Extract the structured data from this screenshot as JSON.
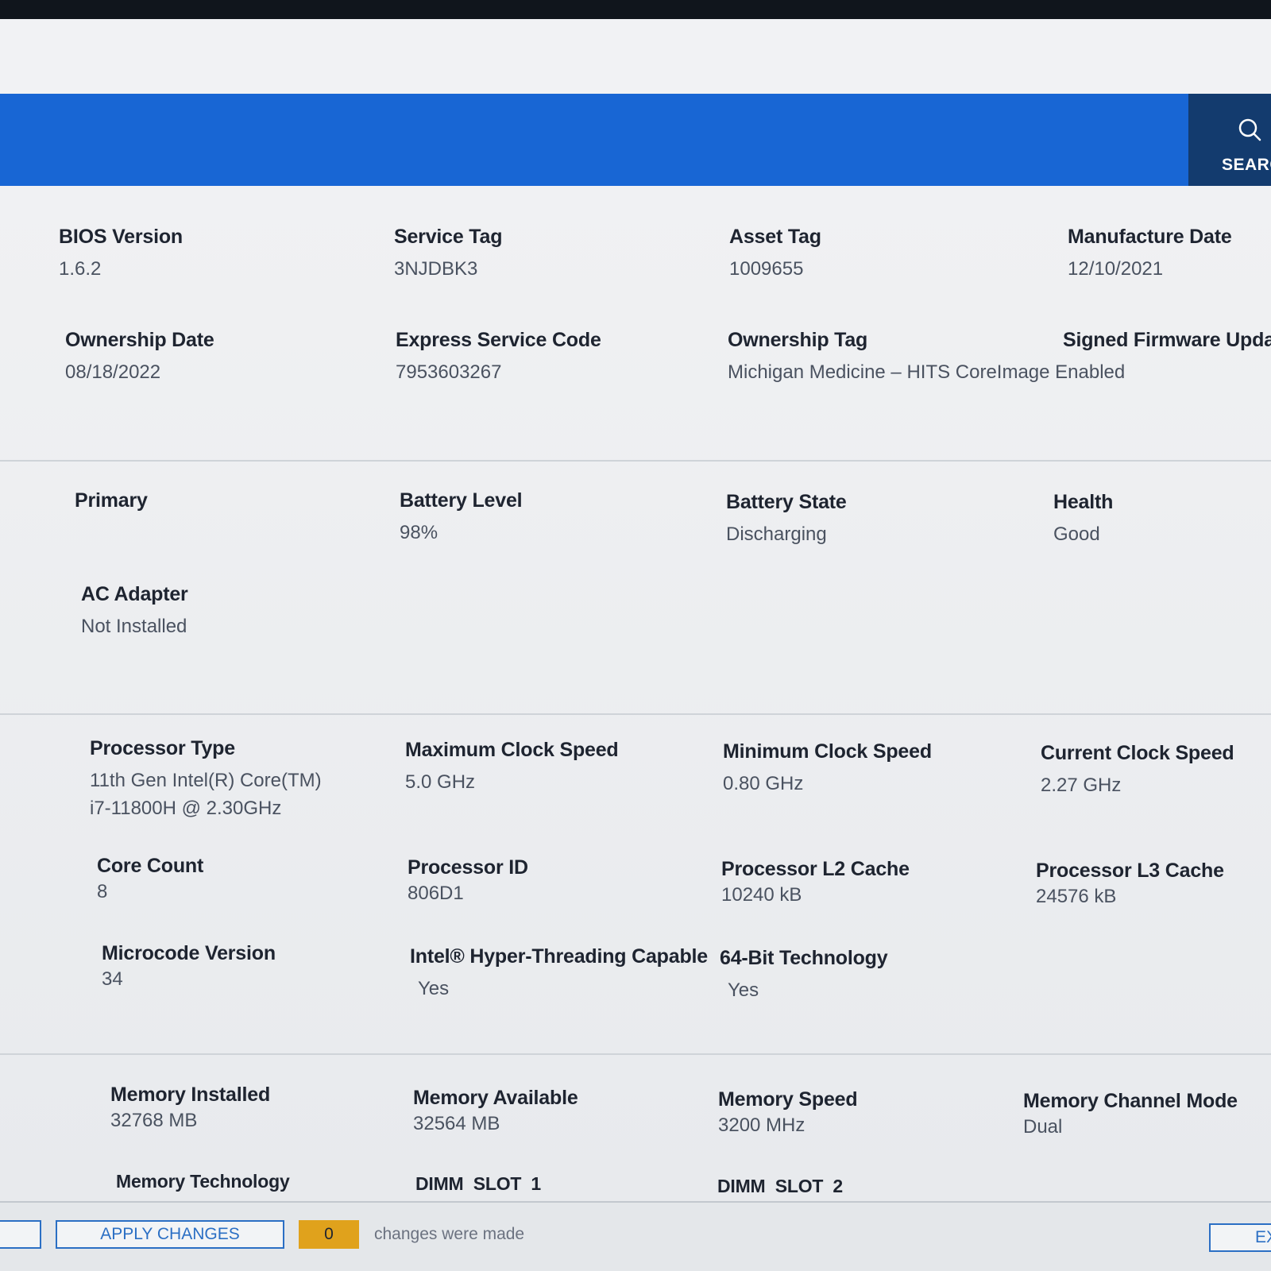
{
  "search": {
    "label": "SEARCH"
  },
  "system": {
    "bios_version": {
      "label": "BIOS Version",
      "value": "1.6.2"
    },
    "service_tag": {
      "label": "Service Tag",
      "value": "3NJDBK3"
    },
    "asset_tag": {
      "label": "Asset Tag",
      "value": "1009655"
    },
    "manufacture_date": {
      "label": "Manufacture Date",
      "value": "12/10/2021"
    },
    "ownership_date": {
      "label": "Ownership Date",
      "value": "08/18/2022"
    },
    "express_service_code": {
      "label": "Express Service Code",
      "value": "7953603267"
    },
    "ownership_tag": {
      "label": "Ownership Tag",
      "value": "Michigan Medicine – HITS CoreImage Enabled"
    },
    "signed_firmware_update": {
      "label": "Signed Firmware Update",
      "value": ""
    }
  },
  "battery": {
    "primary": {
      "label": "Primary"
    },
    "battery_level": {
      "label": "Battery Level",
      "value": "98%"
    },
    "battery_state": {
      "label": "Battery State",
      "value": "Discharging"
    },
    "health": {
      "label": "Health",
      "value": "Good"
    },
    "ac_adapter": {
      "label": "AC Adapter",
      "value": "Not Installed"
    }
  },
  "processor": {
    "processor_type": {
      "label": "Processor Type",
      "value_line1": "11th Gen Intel(R) Core(TM)",
      "value_line2": "i7-11800H @ 2.30GHz"
    },
    "max_clock": {
      "label": "Maximum Clock Speed",
      "value": "5.0 GHz"
    },
    "min_clock": {
      "label": "Minimum Clock Speed",
      "value": "0.80 GHz"
    },
    "current_clock": {
      "label": "Current Clock Speed",
      "value": "2.27 GHz"
    },
    "core_count": {
      "label": "Core Count",
      "value": "8"
    },
    "processor_id": {
      "label": "Processor ID",
      "value": "806D1"
    },
    "l2_cache": {
      "label": "Processor L2 Cache",
      "value": "10240 kB"
    },
    "l3_cache": {
      "label": "Processor L3 Cache",
      "value": "24576 kB"
    },
    "microcode": {
      "label": "Microcode Version",
      "value": "34"
    },
    "hyperthreading": {
      "label": "Intel® Hyper-Threading Capable",
      "value": "Yes"
    },
    "bit64": {
      "label": "64-Bit Technology",
      "value": "Yes"
    }
  },
  "memory": {
    "installed": {
      "label": "Memory Installed",
      "value": "32768 MB"
    },
    "available": {
      "label": "Memory Available",
      "value": "32564 MB"
    },
    "speed": {
      "label": "Memory Speed",
      "value": "3200 MHz"
    },
    "channel_mode": {
      "label": "Memory Channel Mode",
      "value": "Dual"
    },
    "technology": {
      "label": "Memory Technology"
    },
    "dimm1": {
      "label": "DIMM SLOT 1"
    },
    "dimm2": {
      "label": "DIMM SLOT 2"
    }
  },
  "footer": {
    "apply_label": "APPLY CHANGES",
    "change_count": "0",
    "changes_text": "changes were made",
    "exit_label": "EXIT"
  },
  "colors": {
    "header_blue": "#1866d4",
    "search_navy": "#133b6e",
    "count_amber": "#e0a21c"
  }
}
